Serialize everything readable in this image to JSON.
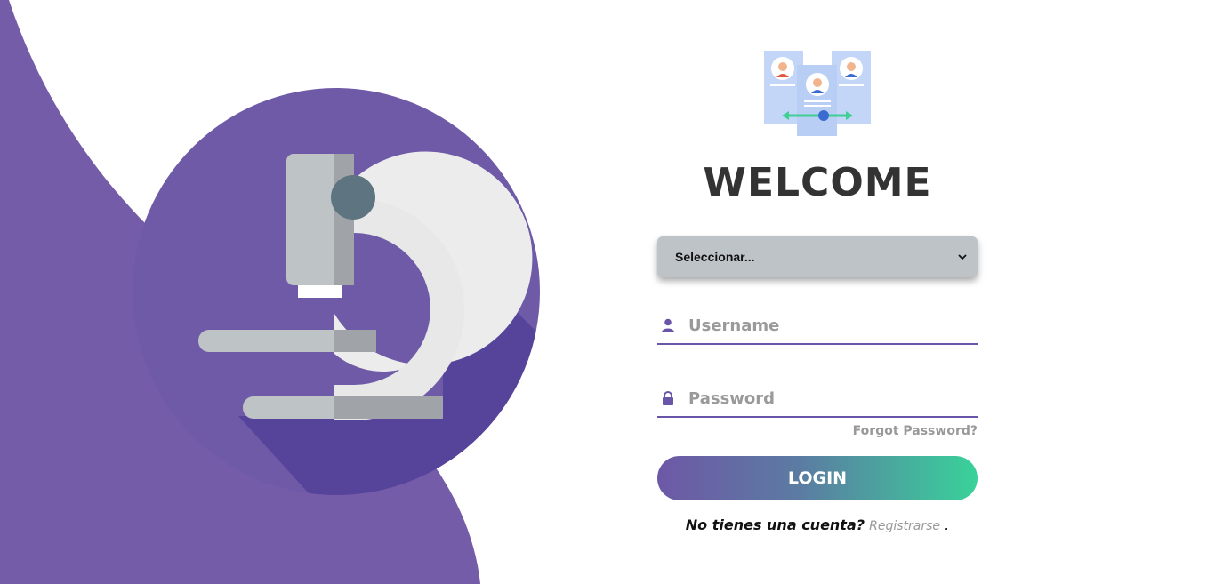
{
  "colors": {
    "brand_purple": "#755ca9",
    "circle_purple": "#6e5aa7",
    "underline": "#6a56a8",
    "gradient_start": "#6d58a6",
    "gradient_end": "#39d29a",
    "select_bg": "#bec3c8"
  },
  "icons": {
    "illustration": "microscope-icon",
    "header_image": "user-profiles-icon",
    "username": "user-icon",
    "password": "lock-icon",
    "select_arrow": "chevron-down-icon"
  },
  "login": {
    "title": "WELCOME",
    "select": {
      "selected": "Seleccionar..."
    },
    "username": {
      "placeholder": "Username",
      "value": ""
    },
    "password": {
      "placeholder": "Password",
      "value": ""
    },
    "forgot_label": "Forgot Password?",
    "login_label": "LOGIN",
    "signup": {
      "question": "No tienes una cuenta?",
      "link": "Registrarse",
      "suffix": "."
    }
  }
}
